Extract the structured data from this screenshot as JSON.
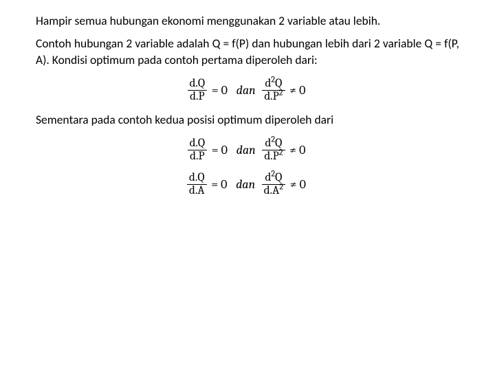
{
  "para1": "Hampir semua hubungan ekonomi menggunakan 2 variable atau lebih.",
  "para2": "Contoh hubungan 2 variable adalah Q = f(P) dan hubungan lebih dari 2 variable Q = f(P, A). Kondisi optimum pada contoh pertama diperoleh dari:",
  "para3": "Sementara pada contoh kedua posisi optimum diperoleh dari",
  "eq": {
    "zero": "= 0",
    "neq_zero": "≠ 0",
    "dan": "dan",
    "dQ": "d.Q",
    "dP": "d.P",
    "dA": "d.A",
    "d2Q_num": "d",
    "d2Q_rest": "Q",
    "dP2_pre": "d.P",
    "dA2_pre": "d.A",
    "sq": "2"
  }
}
